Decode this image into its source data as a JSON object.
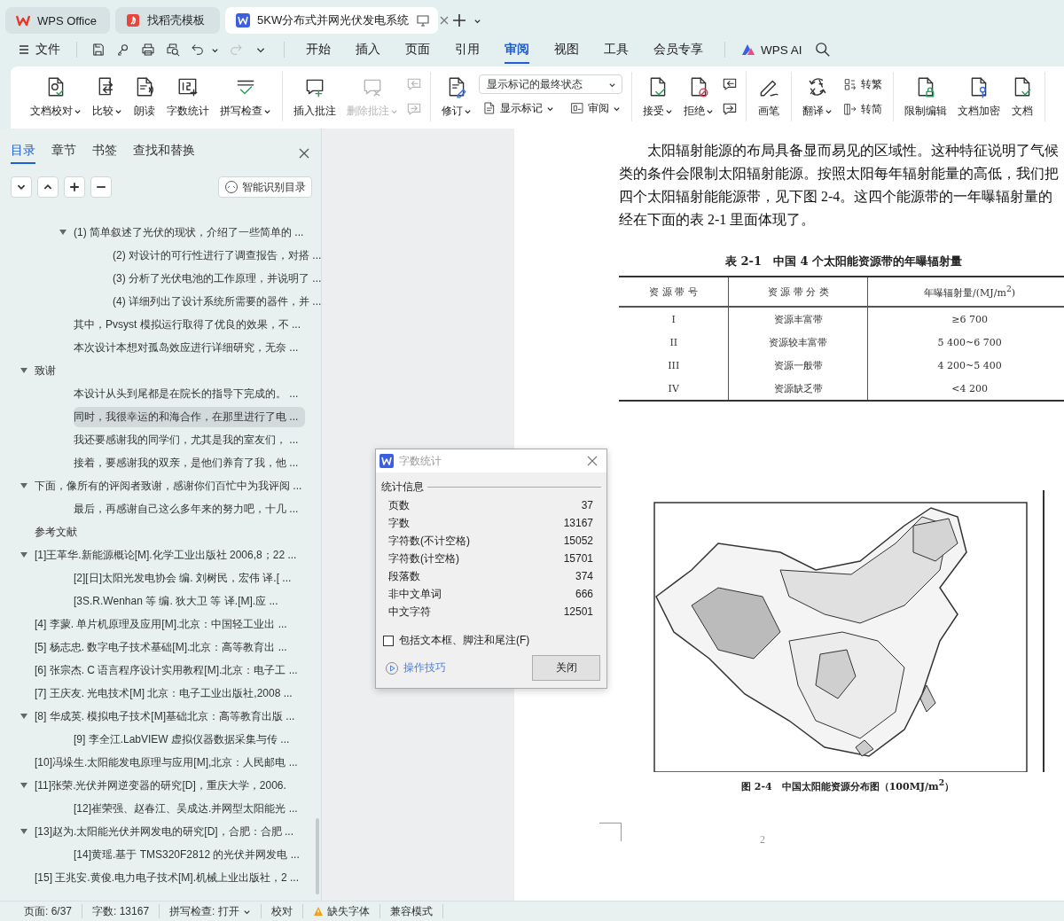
{
  "title_tabs": [
    {
      "label": "WPS Office",
      "selected": false
    },
    {
      "label": "找稻壳模板",
      "selected": false
    },
    {
      "label": "5KW分布式并网光伏发电系统",
      "selected": true
    }
  ],
  "menu": {
    "file": "文件",
    "quick_tools": [
      {
        "disabled": false
      },
      {
        "disabled": false
      },
      {
        "disabled": false
      },
      {
        "disabled": false
      },
      {
        "disabled": false
      },
      {
        "disabled": true
      }
    ],
    "tabs": [
      {
        "label": "开始",
        "selected": false
      },
      {
        "label": "插入",
        "selected": false
      },
      {
        "label": "页面",
        "selected": false
      },
      {
        "label": "引用",
        "selected": false
      },
      {
        "label": "审阅",
        "selected": true
      },
      {
        "label": "视图",
        "selected": false
      },
      {
        "label": "工具",
        "selected": false
      },
      {
        "label": "会员专享",
        "selected": false
      }
    ],
    "ai": "WPS AI"
  },
  "ribbon": [
    {
      "items": [
        {
          "kind": "large",
          "label": "文档校对",
          "dropdown": true,
          "disabled": false
        },
        {
          "kind": "large",
          "label": "比较",
          "dropdown": true,
          "disabled": false
        },
        {
          "kind": "large",
          "label": "朗读",
          "dropdown": false,
          "disabled": false
        },
        {
          "kind": "large",
          "label": "字数统计",
          "dropdown": false,
          "disabled": false
        },
        {
          "kind": "large",
          "label": "拼写检查",
          "dropdown": true,
          "disabled": false
        }
      ]
    },
    {
      "items": [
        {
          "kind": "large",
          "label": "插入批注",
          "dropdown": false,
          "disabled": false
        },
        {
          "kind": "large",
          "label": "删除批注",
          "dropdown": true,
          "disabled": true
        },
        {
          "kind": "stack",
          "items": [
            {
              "kind": "icon",
              "disabled": true
            },
            {
              "kind": "icon",
              "disabled": true
            }
          ]
        }
      ]
    },
    {
      "items": [
        {
          "kind": "large",
          "label": "修订",
          "dropdown": true,
          "disabled": false
        },
        {
          "kind": "panel",
          "select": "显示标记的最终状态",
          "items": [
            {
              "kind": "small",
              "label": "显示标记",
              "dropdown": true,
              "disabled": false
            },
            {
              "kind": "small",
              "label": "审阅",
              "dropdown": true,
              "disabled": false
            }
          ]
        }
      ]
    },
    {
      "items": [
        {
          "kind": "large",
          "label": "接受",
          "dropdown": true,
          "disabled": false
        },
        {
          "kind": "large",
          "label": "拒绝",
          "dropdown": true,
          "disabled": false
        },
        {
          "kind": "stack",
          "items": [
            {
              "kind": "icon",
              "disabled": false
            },
            {
              "kind": "icon",
              "disabled": false
            }
          ]
        }
      ]
    },
    {
      "items": [
        {
          "kind": "large",
          "label": "画笔",
          "dropdown": false,
          "disabled": false
        }
      ]
    },
    {
      "items": [
        {
          "kind": "large",
          "label": "翻译",
          "dropdown": true,
          "disabled": false
        },
        {
          "kind": "stack",
          "items": [
            {
              "kind": "small",
              "label": "转繁",
              "dropdown": false,
              "disabled": false
            },
            {
              "kind": "small",
              "label": "转简",
              "dropdown": false,
              "disabled": false
            }
          ]
        }
      ]
    },
    {
      "items": [
        {
          "kind": "large",
          "label": "限制编辑",
          "dropdown": false,
          "disabled": false
        },
        {
          "kind": "large",
          "label": "文档加密",
          "dropdown": false,
          "disabled": false
        },
        {
          "kind": "large",
          "label": "文档",
          "dropdown": false,
          "disabled": false
        }
      ]
    }
  ],
  "sidebar": {
    "tabs": [
      {
        "label": "目录",
        "selected": true
      },
      {
        "label": "章节",
        "selected": false
      },
      {
        "label": "书签",
        "selected": false
      },
      {
        "label": "查找和替换",
        "selected": false
      }
    ],
    "smart_button": "智能识别目录",
    "toc_continued": [
      {
        "text": "(1) 简单叙述了光伏的现状，介绍了一些简单的 ...",
        "selected": false,
        "expanded": true,
        "children": [
          {
            "text": "(2) 对设计的可行性进行了调查报告，对搭 ...",
            "selected": false
          },
          {
            "text": "(3) 分析了光伏电池的工作原理，并说明了 ...",
            "selected": false
          },
          {
            "text": "(4) 详细列出了设计系统所需要的器件，并 ...",
            "selected": false
          }
        ]
      },
      {
        "text": "其中，Pvsyst 模拟运行取得了优良的效果，不 ...",
        "selected": false
      },
      {
        "text": "本次设计本想对孤岛效应进行详细研究，无奈 ...",
        "selected": false
      }
    ],
    "toc": [
      {
        "text": "致谢",
        "selected": false,
        "expanded": true,
        "children": [
          {
            "text": "本设计从头到尾都是在院长的指导下完成的。 ...",
            "selected": false
          },
          {
            "text": "同时，我很幸运的和海合作，在那里进行了电 ...",
            "selected": true
          },
          {
            "text": "我还要感谢我的同学们，尤其是我的室友们， ...",
            "selected": false
          },
          {
            "text": "接着，要感谢我的双亲，是他们养育了我，他 ...",
            "selected": false
          }
        ]
      },
      {
        "text": "下面，像所有的评阅者致谢，感谢你们百忙中为我评阅 ...",
        "selected": false,
        "expanded": true,
        "children": [
          {
            "text": "最后，再感谢自己这么多年来的努力吧，十几 ...",
            "selected": false
          }
        ]
      },
      {
        "text": "参考文献",
        "selected": false
      },
      {
        "text": "[1]王革华.新能源概论[M].化学工业出版社 2006,8；22 ...",
        "selected": false,
        "expanded": true,
        "children": [
          {
            "text": "[2][日]太阳光发电协会  编. 刘树民，宏伟  译.[ ...",
            "selected": false
          },
          {
            "text": "[3S.R.Wenhan  等  编. 狄大卫  等  译.[M].应 ...",
            "selected": false
          }
        ]
      },
      {
        "text": "[4]   李蒙. 单片机原理及应用[M].北京：中国轻工业出 ...",
        "selected": false
      },
      {
        "text": "[5]   杨志忠. 数字电子技术基础[M].北京：高等教育出 ...",
        "selected": false
      },
      {
        "text": "[6]  张宗杰. C 语言程序设计实用教程[M].北京：电子工 ...",
        "selected": false
      },
      {
        "text": "[7]  王庆友. 光电技术[M]  北京：电子工业出版社,2008 ...",
        "selected": false
      },
      {
        "text": "[8]  华成英. 模拟电子技术[M]基础北京：高等教育出版 ...",
        "selected": false,
        "expanded": true,
        "children": [
          {
            "text": "[9]  李全江.LabVIEW 虚拟仪器数据采集与传 ...",
            "selected": false
          }
        ]
      },
      {
        "text": "[10]冯垛生.太阳能发电原理与应用[M],北京：人民邮电 ...",
        "selected": false
      },
      {
        "text": "[11]张荣.光伏并网逆变器的研究[D]，重庆大学，2006.",
        "selected": false,
        "expanded": true,
        "children": [
          {
            "text": "[12]崔荣强、赵春江、吴成达.并网型太阳能光 ...",
            "selected": false
          }
        ]
      },
      {
        "text": "[13]赵为.太阳能光伏并网发电的研究[D]，合肥：合肥 ...",
        "selected": false,
        "expanded": true,
        "children": [
          {
            "text": "[14]黄瑶.基于 TMS320F2812 的光伏并网发电 ...",
            "selected": false
          }
        ]
      },
      {
        "text": "[15]  王兆安.黄俊.电力电子技术[M].机械上业出版社，2 ...",
        "selected": false
      }
    ]
  },
  "document": {
    "paragraph_lines": [
      "太阳辐射能源的布局具备显而易见的区域性。这种特征说明了气候",
      "类的条件会限制太阳辐射能源。按照太阳每年辐射能量的高低，我们把",
      "四个太阳辐射能能源带，见下图 2-4。这四个能源带的一年曝辐射量的",
      "经在下面的表 2-1 里面体现了。"
    ],
    "table": {
      "title": "表 2-1　中国 4 个太阳能资源带的年曝辐射量",
      "columns": [
        "资 源 带 号",
        "资 源 带 分 类",
        "年曝辐射量/(MJ/m$^{2}$)"
      ],
      "rows": [
        [
          "I",
          "资源丰富带",
          "≥6 700"
        ],
        [
          "II",
          "资源较丰富带",
          "5 400~6 700"
        ],
        [
          "III",
          "资源一般带",
          "4 200~5 400"
        ],
        [
          "IV",
          "资源缺乏带",
          "<4 200"
        ]
      ]
    },
    "figure": {
      "caption": "图 2-4　中国太阳能资源分布图（100MJ/m$^{2}$）"
    },
    "page_number": "2"
  },
  "dialog": {
    "title": "字数统计",
    "section": "统计信息",
    "rows": [
      [
        "页数",
        "37"
      ],
      [
        "字数",
        "13167"
      ],
      [
        "字符数(不计空格)",
        "15052"
      ],
      [
        "字符数(计空格)",
        "15701"
      ],
      [
        "段落数",
        "374"
      ],
      [
        "非中文单词",
        "666"
      ],
      [
        "中文字符",
        "12501"
      ]
    ],
    "checkbox": {
      "label": "包括文本框、脚注和尾注(F)",
      "checked": false
    },
    "tips_link": "操作技巧",
    "close_button": "关闭"
  },
  "status_bar": [
    {
      "kind": "text",
      "text": "页面: 6/37"
    },
    {
      "kind": "text",
      "text": "字数: 13167"
    },
    {
      "kind": "dropdown",
      "text": "拼写检查: 打开"
    },
    {
      "kind": "text",
      "text": "校对"
    },
    {
      "kind": "warning",
      "text": "缺失字体"
    },
    {
      "kind": "text",
      "text": "兼容模式"
    }
  ]
}
